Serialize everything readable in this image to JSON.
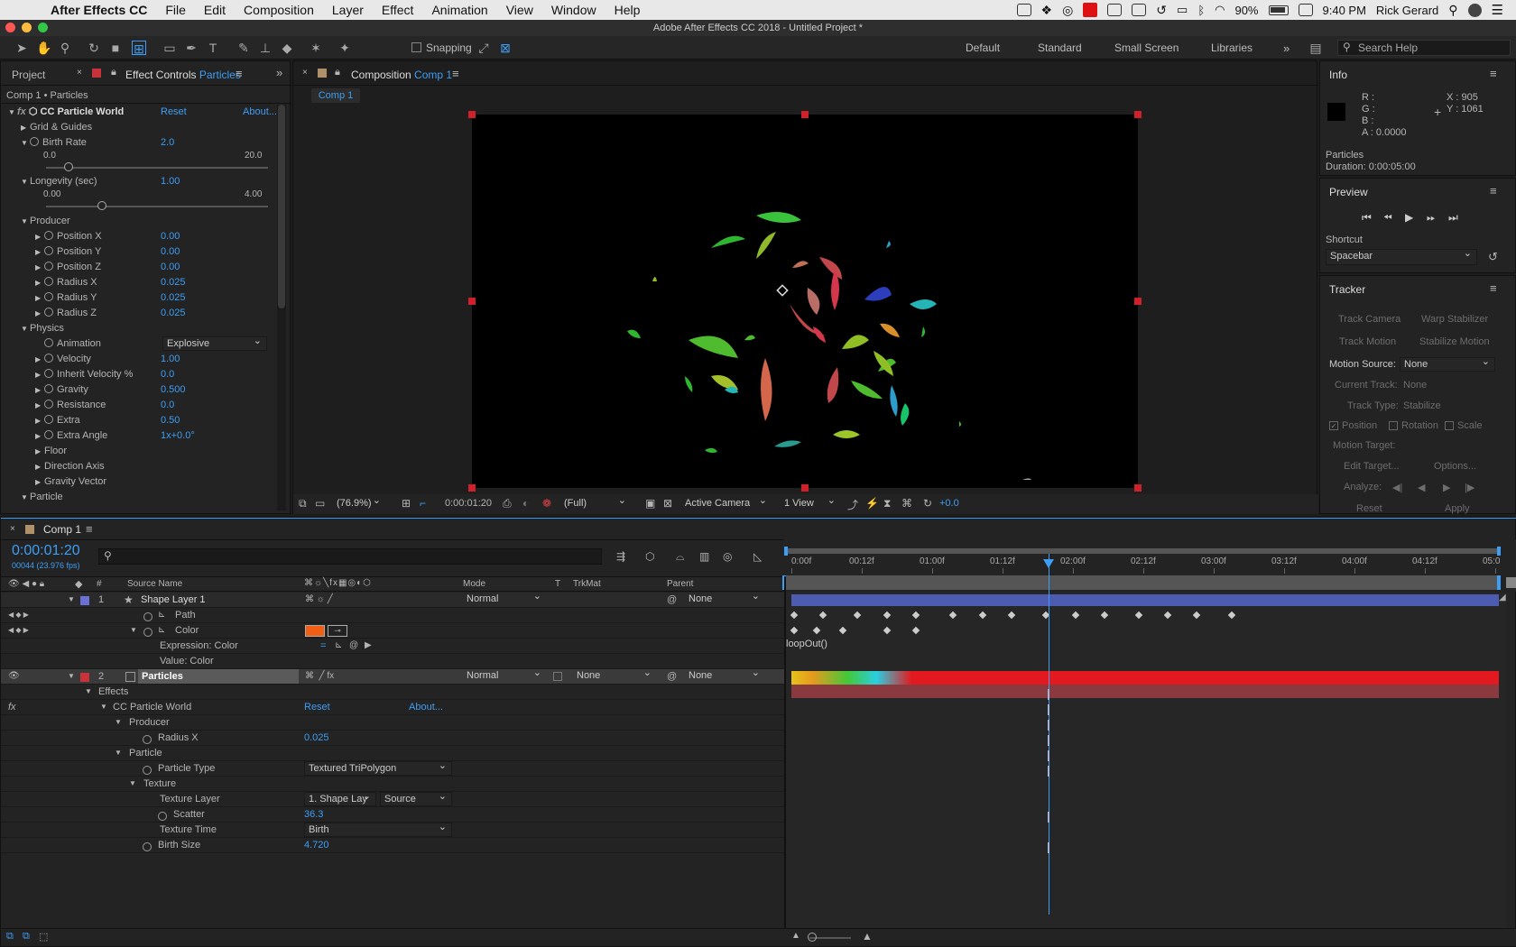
{
  "menubar": {
    "app": "After Effects CC",
    "items": [
      "File",
      "Edit",
      "Composition",
      "Layer",
      "Effect",
      "Animation",
      "View",
      "Window",
      "Help"
    ],
    "battery": "90%",
    "clock": "9:40 PM",
    "user": "Rick Gerard"
  },
  "window": {
    "title": "Adobe After Effects CC 2018 - Untitled Project *"
  },
  "toolbar": {
    "snapping": "Snapping",
    "workspaces": [
      "Default",
      "Standard",
      "Small Screen",
      "Libraries"
    ],
    "search_placeholder": "Search Help"
  },
  "effect_controls": {
    "tab_project": "Project",
    "tab_label": "Effect Controls",
    "tab_layer": "Particles",
    "breadcrumb": "Comp 1 • Particles",
    "effect_name": "CC Particle World",
    "reset": "Reset",
    "about": "About...",
    "grid_guides": "Grid & Guides",
    "birth_rate": {
      "label": "Birth Rate",
      "value": "2.0",
      "min": "0.0",
      "max": "20.0",
      "fraction": 0.1
    },
    "longevity": {
      "label": "Longevity (sec)",
      "value": "1.00",
      "min": "0.00",
      "max": "4.00",
      "fraction": 0.25
    },
    "producer": "Producer",
    "producer_props": [
      {
        "label": "Position X",
        "value": "0.00"
      },
      {
        "label": "Position Y",
        "value": "0.00"
      },
      {
        "label": "Position Z",
        "value": "0.00"
      },
      {
        "label": "Radius X",
        "value": "0.025"
      },
      {
        "label": "Radius Y",
        "value": "0.025"
      },
      {
        "label": "Radius Z",
        "value": "0.025"
      }
    ],
    "physics": "Physics",
    "animation": {
      "label": "Animation",
      "value": "Explosive"
    },
    "physics_props": [
      {
        "label": "Velocity",
        "value": "1.00"
      },
      {
        "label": "Inherit Velocity %",
        "value": "0.0"
      },
      {
        "label": "Gravity",
        "value": "0.500"
      },
      {
        "label": "Resistance",
        "value": "0.0"
      },
      {
        "label": "Extra",
        "value": "0.50"
      },
      {
        "label": "Extra Angle",
        "value": "1x+0.0°"
      }
    ],
    "sub_groups": [
      "Floor",
      "Direction Axis",
      "Gravity Vector"
    ],
    "particle": "Particle"
  },
  "composition": {
    "tab_label": "Composition",
    "tab_comp": "Comp 1",
    "subtab": "Comp 1",
    "zoom": "(76.9%)",
    "timecode": "0:00:01:20",
    "resolution": "(Full)",
    "camera": "Active Camera",
    "view": "1 View",
    "exposure": "+0.0"
  },
  "info": {
    "title": "Info",
    "r": "R :",
    "g": "G :",
    "b": "B :",
    "a": "A :  0.0000",
    "x": "X : 905",
    "y": "Y : 1061",
    "layer": "Particles",
    "duration": "Duration: 0:00:05:00"
  },
  "preview": {
    "title": "Preview",
    "shortcut_label": "Shortcut",
    "shortcut": "Spacebar"
  },
  "tracker": {
    "title": "Tracker",
    "track_camera": "Track Camera",
    "warp_stabilizer": "Warp Stabilizer",
    "track_motion": "Track Motion",
    "stabilize_motion": "Stabilize Motion",
    "motion_source_label": "Motion Source:",
    "motion_source": "None",
    "current_track_label": "Current Track:",
    "current_track": "None",
    "track_type_label": "Track Type:",
    "track_type": "Stabilize",
    "position": "Position",
    "rotation": "Rotation",
    "scale": "Scale",
    "motion_target": "Motion Target:",
    "edit_target": "Edit Target...",
    "options": "Options...",
    "analyze": "Analyze:",
    "reset": "Reset",
    "apply": "Apply"
  },
  "timeline": {
    "tab": "Comp 1",
    "timecode": "0:00:01:20",
    "frames": "00044 (23.976 fps)",
    "col_source": "Source Name",
    "col_mode": "Mode",
    "col_t": "T",
    "col_trkmat": "TrkMat",
    "col_parent": "Parent",
    "ruler": [
      "0:00f",
      "00:12f",
      "01:00f",
      "01:12f",
      "02:00f",
      "02:12f",
      "03:00f",
      "03:12f",
      "04:00f",
      "04:12f",
      "05:0"
    ],
    "layer1": {
      "num": "1",
      "name": "Shape Layer 1",
      "mode": "Normal",
      "parent": "None"
    },
    "path": "Path",
    "color": "Color",
    "expression_color": "Expression: Color",
    "value_color": "Value: Color",
    "expression_text": "loopOut()",
    "layer2": {
      "num": "2",
      "name": "Particles",
      "mode": "Normal",
      "trkmat": "None",
      "parent": "None"
    },
    "effects": "Effects",
    "effect": "CC Particle World",
    "reset": "Reset",
    "about": "About...",
    "producer": "Producer",
    "radius_x": {
      "label": "Radius X",
      "value": "0.025"
    },
    "particle": "Particle",
    "particle_type": {
      "label": "Particle Type",
      "value": "Textured TriPolygon"
    },
    "texture": "Texture",
    "texture_layer": {
      "label": "Texture Layer",
      "value": "1. Shape Lay",
      "source": "Source"
    },
    "scatter": {
      "label": "Scatter",
      "value": "36.3"
    },
    "texture_time": {
      "label": "Texture Time",
      "value": "Birth"
    },
    "birth_size": {
      "label": "Birth Size",
      "value": "4.720"
    }
  },
  "colors": {
    "accent": "#3d9ef5",
    "layer1_label": "#6b70d6",
    "layer2_label": "#c8333b",
    "bar_blue": "#4d5cb0",
    "bar_red": "#e21a1f",
    "swatch_orange": "#f25f14"
  }
}
